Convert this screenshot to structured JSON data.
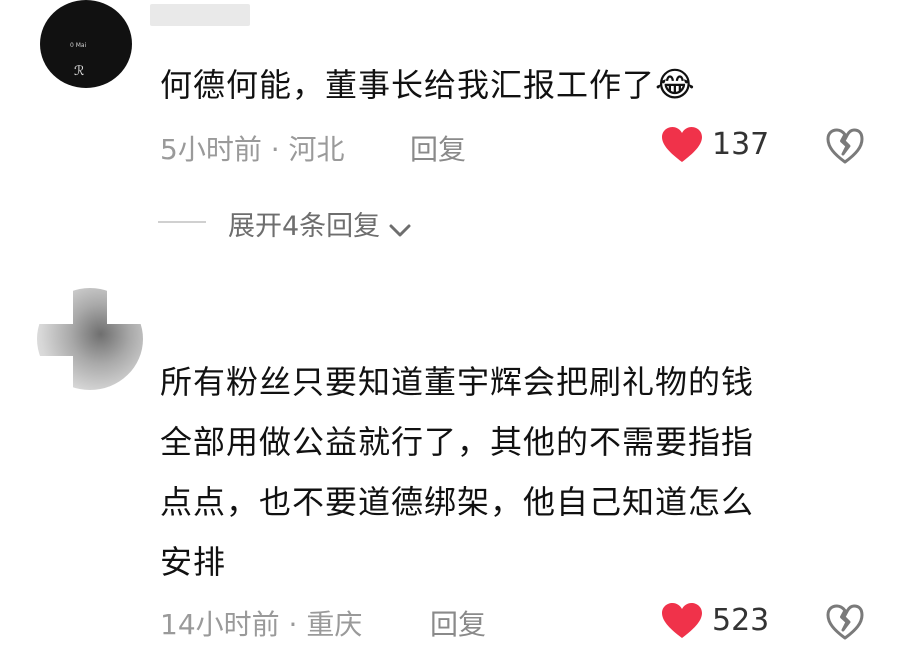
{
  "comments": [
    {
      "text": "何德何能，董事长给我汇报工作了",
      "emoji": "😂",
      "meta": "5小时前 · 河北",
      "reply_label": "回复",
      "likes": "137",
      "avatar_text": "0 Mai",
      "expand_label": "展开4条回复"
    },
    {
      "text_lines": [
        "所有粉丝只要知道董宇辉会把刷礼物的钱",
        "全部用做公益就行了，其他的不需要指指",
        "点点，也不要道德绑架，他自己知道怎么",
        "安排"
      ],
      "meta": "14小时前 · 重庆",
      "reply_label": "回复",
      "likes": "523"
    }
  ],
  "icons": {
    "like": "heart-icon",
    "dislike": "broken-heart-icon",
    "expand": "chevron-down-icon"
  },
  "colors": {
    "like_heart": "#f0324a",
    "meta_text": "#9a9a9a"
  }
}
